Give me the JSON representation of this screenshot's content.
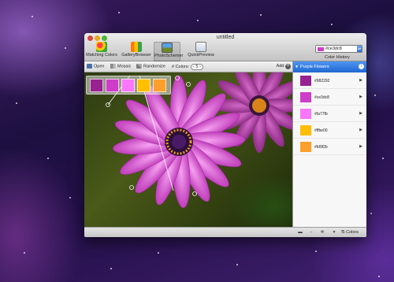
{
  "window": {
    "title": "untitled"
  },
  "toolbar": {
    "items": [
      {
        "label": "Matching Colors",
        "icon": "color-wheel-icon"
      },
      {
        "label": "GalleryBrowser",
        "icon": "gallery-icon"
      },
      {
        "label": "PhotoSchemer",
        "icon": "photo-icon",
        "active": true
      },
      {
        "label": "QuickPreview",
        "icon": "preview-icon"
      }
    ],
    "color_input": {
      "value": "#ce3dc8",
      "swatch": "#ce3dc8"
    },
    "color_history_label": "Color History"
  },
  "subtoolbar": {
    "open_label": "Open",
    "mosaic_label": "Mosaic",
    "randomize_label": "Randomize",
    "colors_label": "# Colors:",
    "colors_value": "5",
    "add_label": "Add"
  },
  "scheme": {
    "name": "Purple Flowers",
    "colors": [
      {
        "hex": "#982292"
      },
      {
        "hex": "#ce3dc8"
      },
      {
        "hex": "#fa77fb"
      },
      {
        "hex": "#ffbe00"
      },
      {
        "hex": "#fd9f2b"
      }
    ]
  },
  "bottombar": {
    "count_label": "5 Colors"
  }
}
